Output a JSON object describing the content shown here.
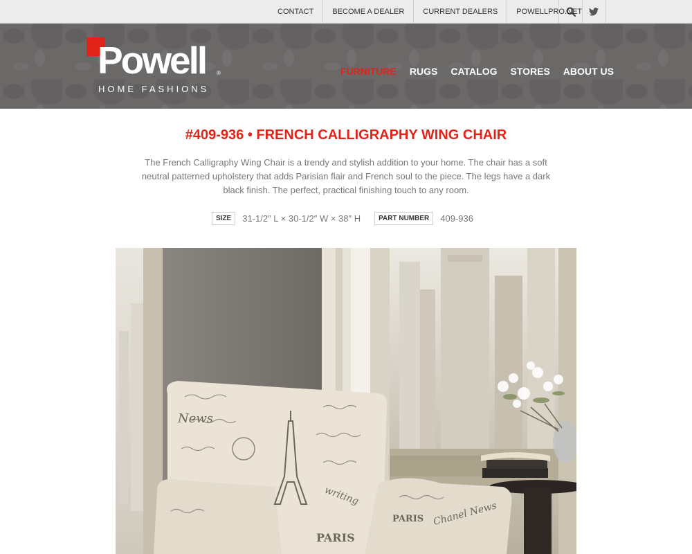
{
  "utility_nav": {
    "links": [
      "CONTACT",
      "BECOME A DEALER",
      "CURRENT DEALERS",
      "POWELLPRO.NET"
    ],
    "icons": [
      "search-icon",
      "twitter-icon"
    ]
  },
  "logo": {
    "wordmark": "Powell",
    "tagline": "HOME FASHIONS",
    "registered": "®",
    "brand_red": "#e2231a"
  },
  "main_nav": {
    "items": [
      "FURNITURE",
      "RUGS",
      "CATALOG",
      "STORES",
      "ABOUT US"
    ],
    "active": "FURNITURE"
  },
  "product": {
    "title": "#409-936 • FRENCH CALLIGRAPHY WING CHAIR",
    "description": "The French Calligraphy Wing Chair is a trendy and stylish addition to your home. The chair has a soft neutral patterned upholstery that adds Parisian flair and French soul to the piece. The legs have a dark black finish. The perfect, practical finishing touch to any room.",
    "specs": {
      "size_label": "SIZE",
      "size_value": "31-1/2″ L × 30-1/2″ W × 38″ H",
      "part_label": "PART NUMBER",
      "part_value": "409-936"
    }
  },
  "photo": {
    "chair_text": [
      "PARIS",
      "News",
      "PARIS",
      "Chanel News",
      "writing"
    ]
  },
  "colors": {
    "accent": "#e2231a",
    "header_bg": "#6b6868",
    "utility_bg": "#ececec"
  }
}
